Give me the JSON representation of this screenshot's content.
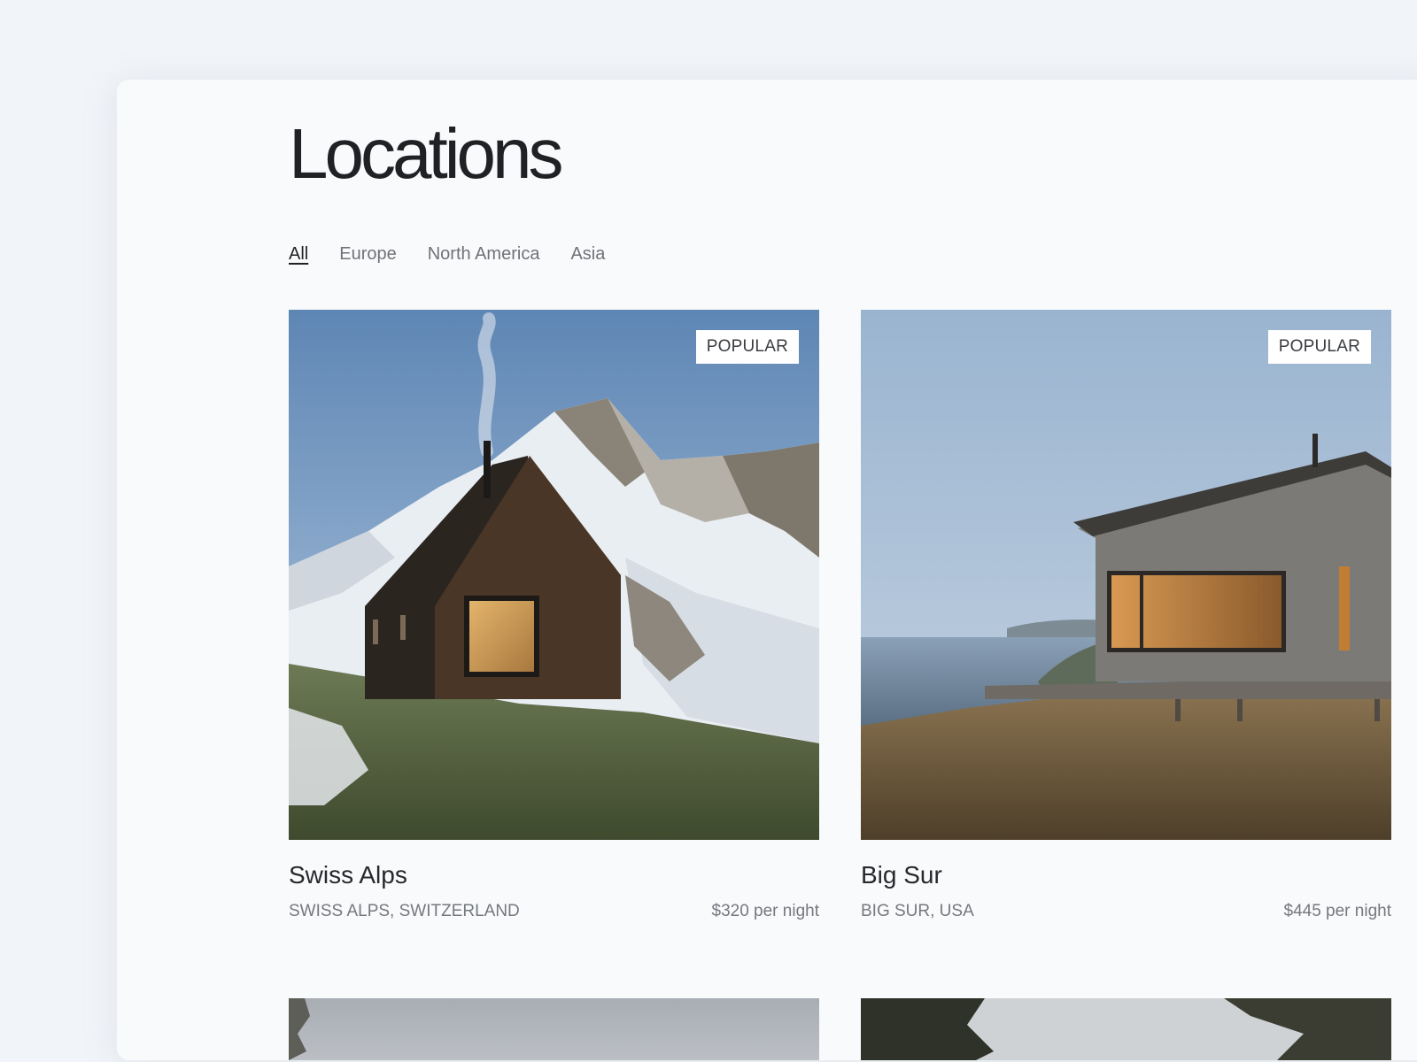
{
  "page": {
    "title": "Locations"
  },
  "filters": [
    {
      "label": "All",
      "active": true
    },
    {
      "label": "Europe",
      "active": false
    },
    {
      "label": "North America",
      "active": false
    },
    {
      "label": "Asia",
      "active": false
    }
  ],
  "cards": [
    {
      "name": "Swiss Alps",
      "location": "SWISS ALPS, SWITZERLAND",
      "price": "$320 per night",
      "badge": "POPULAR"
    },
    {
      "name": "Big Sur",
      "location": "BIG SUR, USA",
      "price": "$445 per night",
      "badge": "POPULAR"
    }
  ],
  "colors": {
    "background": "#f1f4f8",
    "panel": "#f9fafb",
    "text": "#1f2124",
    "muted": "#6f7278"
  }
}
